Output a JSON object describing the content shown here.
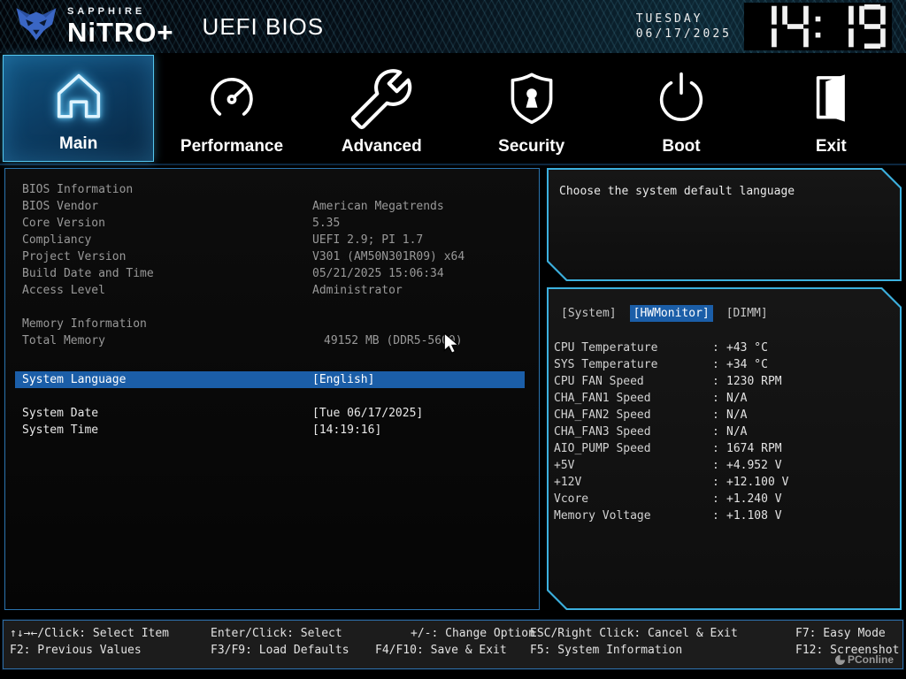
{
  "colors": {
    "accent_cyan": "#3cb0de",
    "highlight_blue": "#1b5ea8",
    "selected_tab_border": "#54c7ef",
    "brand_blue": "#3a66c4",
    "text_gray": "#999999",
    "text_white": "#e8e8e8"
  },
  "header": {
    "brand_top": "SAPPHIRE",
    "brand_name": "NiTRO+",
    "brand_logo_icon": "nitro-fox-logo-icon",
    "title": "UEFI BIOS",
    "weekday": "TUESDAY",
    "date": "06/17/2025",
    "time": "14:19"
  },
  "nav": {
    "tabs": [
      {
        "label": "Main",
        "icon": "home-icon",
        "selected": true
      },
      {
        "label": "Performance",
        "icon": "gauge-icon",
        "selected": false
      },
      {
        "label": "Advanced",
        "icon": "wrench-icon",
        "selected": false
      },
      {
        "label": "Security",
        "icon": "shield-keyhole-icon",
        "selected": false
      },
      {
        "label": "Boot",
        "icon": "power-icon",
        "selected": false
      },
      {
        "label": "Exit",
        "icon": "exit-door-icon",
        "selected": false
      }
    ]
  },
  "main_panel": {
    "section1_title": "BIOS Information",
    "bios_rows": [
      {
        "label": "BIOS Vendor",
        "value": "American Megatrends"
      },
      {
        "label": "Core Version",
        "value": "5.35"
      },
      {
        "label": "Compliancy",
        "value": "UEFI 2.9; PI 1.7"
      },
      {
        "label": "Project Version",
        "value": "V301 (AM50N301R09) x64"
      },
      {
        "label": "Build Date and Time",
        "value": "05/21/2025 15:06:34"
      },
      {
        "label": "Access Level",
        "value": "Administrator"
      }
    ],
    "section2_title": "Memory Information",
    "memory_row": {
      "label": "Total Memory",
      "value": "49152 MB (DDR5-5600)"
    },
    "language_row": {
      "label": "System Language",
      "value": "[English]"
    },
    "date_row": {
      "label": "System Date",
      "value": "[Tue 06/17/2025]"
    },
    "time_row": {
      "label": "System Time",
      "value": "[14:19:16]"
    }
  },
  "help_panel": {
    "text": "Choose the system default language"
  },
  "hw_panel": {
    "separator": ":",
    "tabs": [
      {
        "label": "[System]",
        "selected": false
      },
      {
        "label": "[HWMonitor]",
        "selected": true
      },
      {
        "label": "[DIMM]",
        "selected": false
      }
    ],
    "rows": [
      {
        "label": "CPU Temperature",
        "value": "+43 °C"
      },
      {
        "label": "SYS Temperature",
        "value": "+34 °C"
      },
      {
        "label": "CPU FAN Speed",
        "value": "1230 RPM"
      },
      {
        "label": "CHA_FAN1 Speed",
        "value": "N/A"
      },
      {
        "label": "CHA_FAN2 Speed",
        "value": "N/A"
      },
      {
        "label": "CHA_FAN3 Speed",
        "value": "N/A"
      },
      {
        "label": "AIO_PUMP Speed",
        "value": "1674 RPM"
      },
      {
        "label": "+5V",
        "value": "+4.952 V"
      },
      {
        "label": "+12V",
        "value": "+12.100 V"
      },
      {
        "label": "Vcore",
        "value": "+1.240 V"
      },
      {
        "label": "Memory Voltage",
        "value": "+1.108 V"
      }
    ]
  },
  "footer": {
    "row1": [
      "↑↓→←/Click: Select Item",
      "Enter/Click: Select",
      "+/-: Change Option",
      "ESC/Right Click: Cancel & Exit",
      "F7: Easy Mode"
    ],
    "row2": [
      "F2: Previous Values",
      "F3/F9: Load Defaults",
      "F4/F10: Save & Exit",
      "F5: System Information",
      "F12: Screenshot"
    ],
    "watermark": "PConline",
    "watermark_icon": "pconline-logo-icon"
  }
}
